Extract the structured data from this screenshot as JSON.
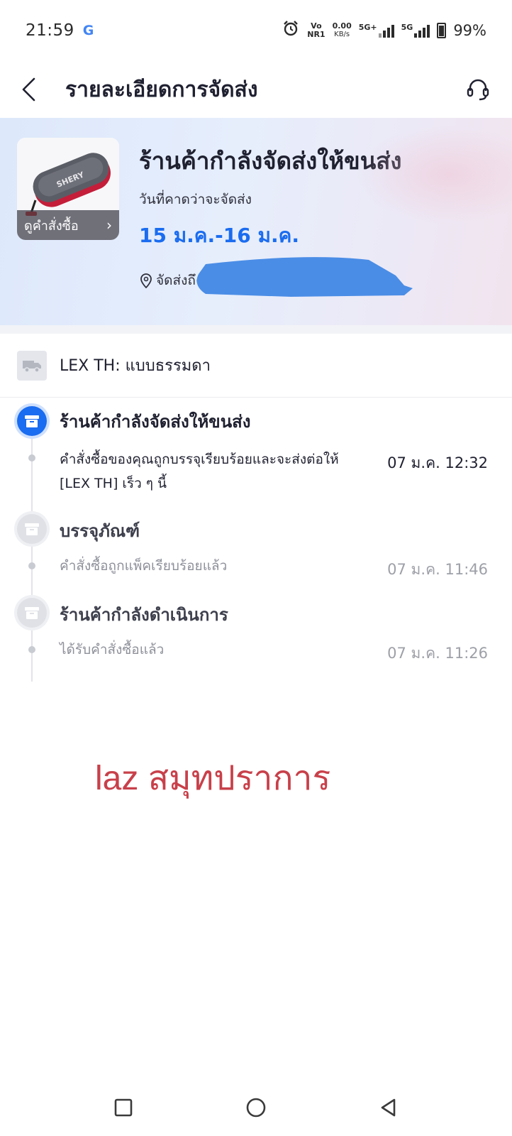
{
  "status_bar": {
    "time": "21:59",
    "g_logo": "G",
    "volte_top": "Vo",
    "volte_bottom": "NR1",
    "speed_top": "0.00",
    "speed_bottom": "KB/s",
    "net1": "5G+",
    "net2": "5G",
    "battery": "99%",
    "icons": [
      "alarm-icon",
      "signal-icon",
      "battery-icon"
    ]
  },
  "header": {
    "title": "รายละเอียดการจัดส่ง",
    "back_icon": "chevron-left-icon",
    "support_icon": "headset-icon"
  },
  "hero": {
    "status": "ร้านค้ากำลังจัดส่งให้ขนส่ง",
    "est_label": "วันที่คาดว่าจะจัดส่ง",
    "est_date": "15 ม.ค.-16 ม.ค.",
    "ship_to_label": "จัดส่งถึง",
    "view_order": "ดูคำสั่งซื้อ",
    "product_brand": "SHERY"
  },
  "carrier": {
    "name": "LEX TH: แบบธรรมดา"
  },
  "timeline": [
    {
      "title": "ร้านค้ากำลังจัดส่งให้ขนส่ง",
      "desc_line1": "คำสั่งซื้อของคุณถูกบรรจุเรียบร้อยและจะส่งต่อให้",
      "desc_line2": "[LEX TH] เร็ว ๆ นี้",
      "time": "07 ม.ค. 12:32",
      "active": true
    },
    {
      "title": "บรรจุภัณฑ์",
      "desc_line1": "คำสั่งซื้อถูกแพ็คเรียบร้อยแล้ว",
      "time": "07 ม.ค. 11:46",
      "active": false
    },
    {
      "title": "ร้านค้ากำลังดำเนินการ",
      "desc_line1": "ได้รับคำสั่งซื้อแล้ว",
      "time": "07 ม.ค. 11:26",
      "active": false
    }
  ],
  "watermark": "laz สมุทปราการ",
  "colors": {
    "accent": "#1a6cf0",
    "watermark": "#c8404a"
  }
}
